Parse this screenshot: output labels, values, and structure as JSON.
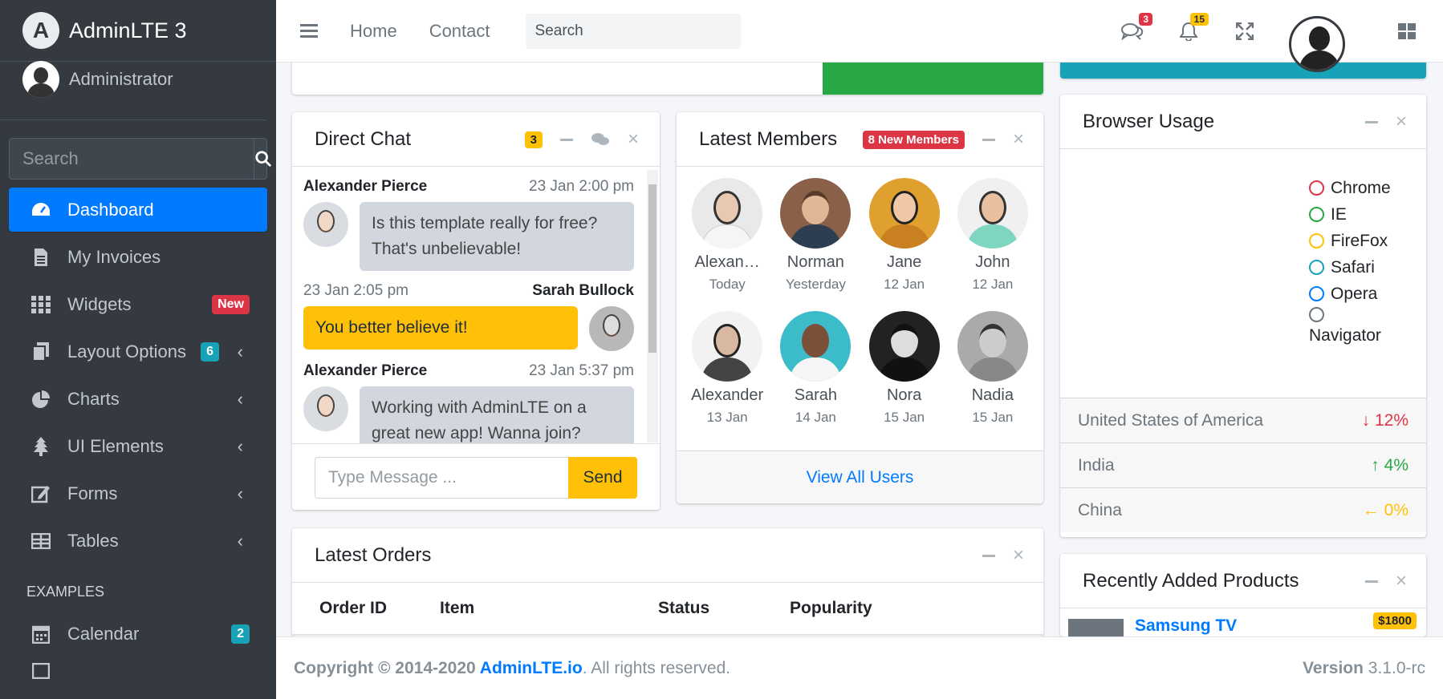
{
  "brand": {
    "name": "AdminLTE 3"
  },
  "user": {
    "name": "Administrator"
  },
  "sidebar": {
    "search_placeholder": "Search",
    "items": [
      {
        "label": "Dashboard"
      },
      {
        "label": "My Invoices"
      },
      {
        "label": "Widgets",
        "badge": "New"
      },
      {
        "label": "Layout Options",
        "badge": "6"
      },
      {
        "label": "Charts"
      },
      {
        "label": "UI Elements"
      },
      {
        "label": "Forms"
      },
      {
        "label": "Tables"
      }
    ],
    "header": "EXAMPLES",
    "calendar": {
      "label": "Calendar",
      "badge": "2"
    }
  },
  "topnav": {
    "home": "Home",
    "contact": "Contact",
    "search_placeholder": "Search",
    "messages_count": "3",
    "notifications_count": "15"
  },
  "chat": {
    "title": "Direct Chat",
    "badge": "3",
    "messages": [
      {
        "name": "Alexander Pierce",
        "time": "23 Jan 2:00 pm",
        "text": "Is this template really for free? That's unbelievable!"
      },
      {
        "name": "Sarah Bullock",
        "time": "23 Jan 2:05 pm",
        "text": "You better believe it!"
      },
      {
        "name": "Alexander Pierce",
        "time": "23 Jan 5:37 pm",
        "text": "Working with AdminLTE on a great new app! Wanna join?"
      }
    ],
    "input_placeholder": "Type Message ...",
    "send_label": "Send"
  },
  "members": {
    "title": "Latest Members",
    "badge": "8 New Members",
    "list": [
      {
        "name": "Alexan…",
        "date": "Today"
      },
      {
        "name": "Norman",
        "date": "Yesterday"
      },
      {
        "name": "Jane",
        "date": "12 Jan"
      },
      {
        "name": "John",
        "date": "12 Jan"
      },
      {
        "name": "Alexander",
        "date": "13 Jan"
      },
      {
        "name": "Sarah",
        "date": "14 Jan"
      },
      {
        "name": "Nora",
        "date": "15 Jan"
      },
      {
        "name": "Nadia",
        "date": "15 Jan"
      }
    ],
    "footer_link": "View All Users"
  },
  "browser": {
    "title": "Browser Usage",
    "legend": [
      {
        "label": "Chrome",
        "color": "#dc3545"
      },
      {
        "label": "IE",
        "color": "#28a745"
      },
      {
        "label": "FireFox",
        "color": "#ffc107"
      },
      {
        "label": "Safari",
        "color": "#17a2b8"
      },
      {
        "label": "Opera",
        "color": "#007bff"
      },
      {
        "label": "Navigator",
        "color": "#6c757d"
      }
    ],
    "countries": [
      {
        "name": "United States of America",
        "value": "12%",
        "arrow": "↓",
        "color": "#dc3545"
      },
      {
        "name": "India",
        "value": "4%",
        "arrow": "↑",
        "color": "#28a745"
      },
      {
        "name": "China",
        "value": "0%",
        "arrow": "←",
        "color": "#ffc107"
      }
    ]
  },
  "orders": {
    "title": "Latest Orders",
    "columns": [
      "Order ID",
      "Item",
      "Status",
      "Popularity"
    ]
  },
  "products": {
    "title": "Recently Added Products",
    "first": {
      "name": "Samsung TV",
      "price": "$1800"
    }
  },
  "footer": {
    "copyright_prefix": "Copyright © 2014-2020 ",
    "link": "AdminLTE.io",
    "suffix": ". All rights reserved.",
    "version_label": "Version",
    "version": "3.1.0-rc"
  }
}
